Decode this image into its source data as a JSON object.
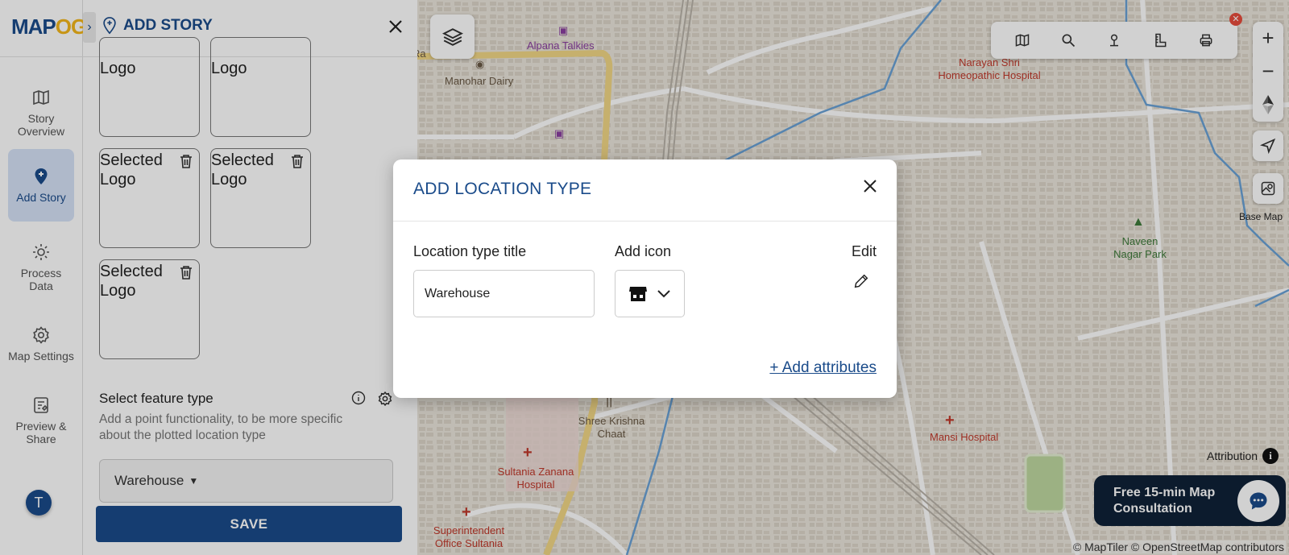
{
  "app": {
    "logo": "MAP",
    "logo_accent": "OG",
    "brand_color": "#1a4b8a",
    "accent_color": "#f3b61b"
  },
  "nav": {
    "items": [
      {
        "label": "Story Overview",
        "icon": "map-book-icon"
      },
      {
        "label": "Add Story",
        "icon": "add-location-icon",
        "active": true
      },
      {
        "label": "Process Data",
        "icon": "gear-process-icon"
      },
      {
        "label": "Map Settings",
        "icon": "settings-icon"
      },
      {
        "label": "Preview & Share",
        "icon": "preview-icon"
      }
    ],
    "avatar_initial": "T"
  },
  "panel": {
    "title": "ADD STORY",
    "logo_cards": [
      {
        "text": "Logo"
      },
      {
        "text": "Logo"
      },
      {
        "text": "Selected Logo"
      },
      {
        "text": "Selected Logo"
      },
      {
        "text": "Selected Logo"
      }
    ],
    "feature_type": {
      "title": "Select feature type",
      "description": "Add a point functionality, to be more specific about the plotted location type",
      "selected": "Warehouse"
    },
    "save_label": "SAVE"
  },
  "modal": {
    "title": "ADD LOCATION TYPE",
    "location_title_label": "Location type title",
    "location_title_value": "Warehouse",
    "add_icon_label": "Add icon",
    "selected_icon": "store-icon",
    "edit_label": "Edit",
    "add_attributes_label": "+ Add attributes"
  },
  "map": {
    "labels": {
      "alpana": "Alpana Talkies",
      "manohar": "Manohar Dairy",
      "narayan": "Narayan Shri Homeopathic Hospital",
      "naveen": "Naveen Nagar Park",
      "shree": "Shree Krishna Chaat",
      "mansi": "Mansi Hospital",
      "sultania": "Sultania Zanana Hospital",
      "superintendent": "Superintendent Office Sultania",
      "ra": "Ra"
    },
    "base_map_label": "Base Map",
    "attribution_label": "Attribution",
    "consultation_label": "Free 15-min Map Consultation",
    "copyright": "© MapTiler © OpenStreetMap contributors"
  }
}
